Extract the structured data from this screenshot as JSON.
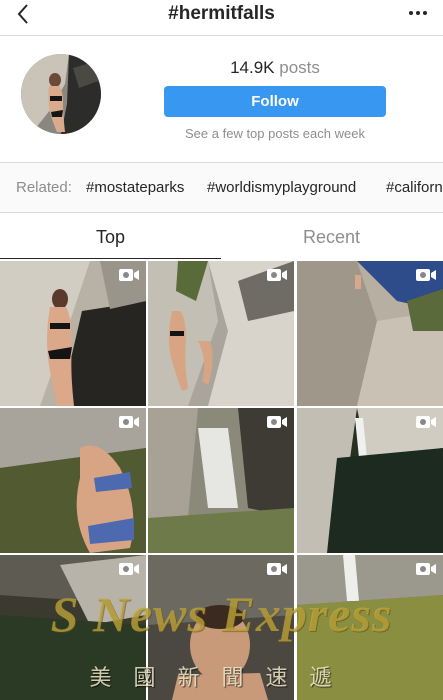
{
  "nav": {
    "title": "#hermitfalls",
    "back_icon": "chevron-left-icon",
    "more_icon": "more-horizontal-icon"
  },
  "header": {
    "posts_count": "14.9K",
    "posts_label": "posts",
    "follow_label": "Follow",
    "note": "See a few top posts each week"
  },
  "related": {
    "label": "Related:",
    "tags": [
      "#mostateparks",
      "#worldismyplayground",
      "#californ"
    ]
  },
  "tabs": [
    {
      "label": "Top",
      "active": true
    },
    {
      "label": "Recent",
      "active": false
    }
  ],
  "grid": {
    "items": [
      {
        "type": "video"
      },
      {
        "type": "video"
      },
      {
        "type": "video"
      },
      {
        "type": "video"
      },
      {
        "type": "video"
      },
      {
        "type": "video"
      },
      {
        "type": "video"
      },
      {
        "type": "video"
      },
      {
        "type": "video"
      }
    ]
  },
  "watermark": {
    "line1": "S News Express",
    "line2": "美國新聞速遞"
  },
  "colors": {
    "accent": "#3897f0",
    "border": "#dbdbdb",
    "muted": "#8e8e8e",
    "text": "#262626"
  }
}
